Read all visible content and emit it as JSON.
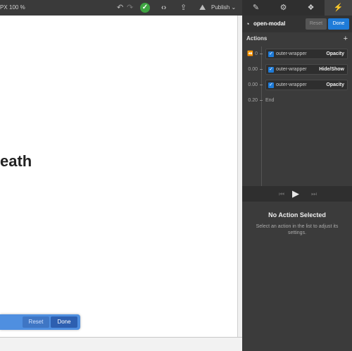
{
  "toolbar": {
    "units_label": "PX",
    "zoom_label": "100 %",
    "publish_label": "Publish",
    "publish_chevron": "⌄",
    "icons": [
      "undo-icon",
      "redo-icon",
      "check-circle-icon",
      "code-icon",
      "export-icon",
      "publish-icon"
    ]
  },
  "panel_tabs": [
    {
      "name": "style-tab",
      "icon": "brush-icon",
      "glyph": "✎"
    },
    {
      "name": "settings-tab",
      "icon": "gear-icon",
      "glyph": "⚙"
    },
    {
      "name": "assets-tab",
      "icon": "drops-icon",
      "glyph": "❖"
    },
    {
      "name": "interactions-tab",
      "icon": "bolt-icon",
      "glyph": "⚡"
    }
  ],
  "canvas": {
    "heading_fragment": "eath"
  },
  "modal_bar": {
    "reset_label": "Reset",
    "done_label": "Done"
  },
  "interaction": {
    "name": "open-modal",
    "reset_label": "Reset",
    "done_label": "Done"
  },
  "actions": {
    "header": "Actions",
    "add_symbol": "+",
    "items": [
      {
        "time": "0",
        "target": "outer-wrapper",
        "type": "Opacity"
      },
      {
        "time": "0.00",
        "target": "outer-wrapper",
        "type": "Hide/Show"
      },
      {
        "time": "0.00",
        "target": "outer-wrapper",
        "type": "Opacity"
      }
    ],
    "end": {
      "time": "0.20",
      "label": "End"
    }
  },
  "empty_state": {
    "title": "No Action Selected",
    "description": "Select an action in the list to adjust its settings."
  },
  "colors": {
    "accent": "#1e7bd8",
    "success": "#3ea341",
    "panel_bg": "#3b3b3b"
  }
}
